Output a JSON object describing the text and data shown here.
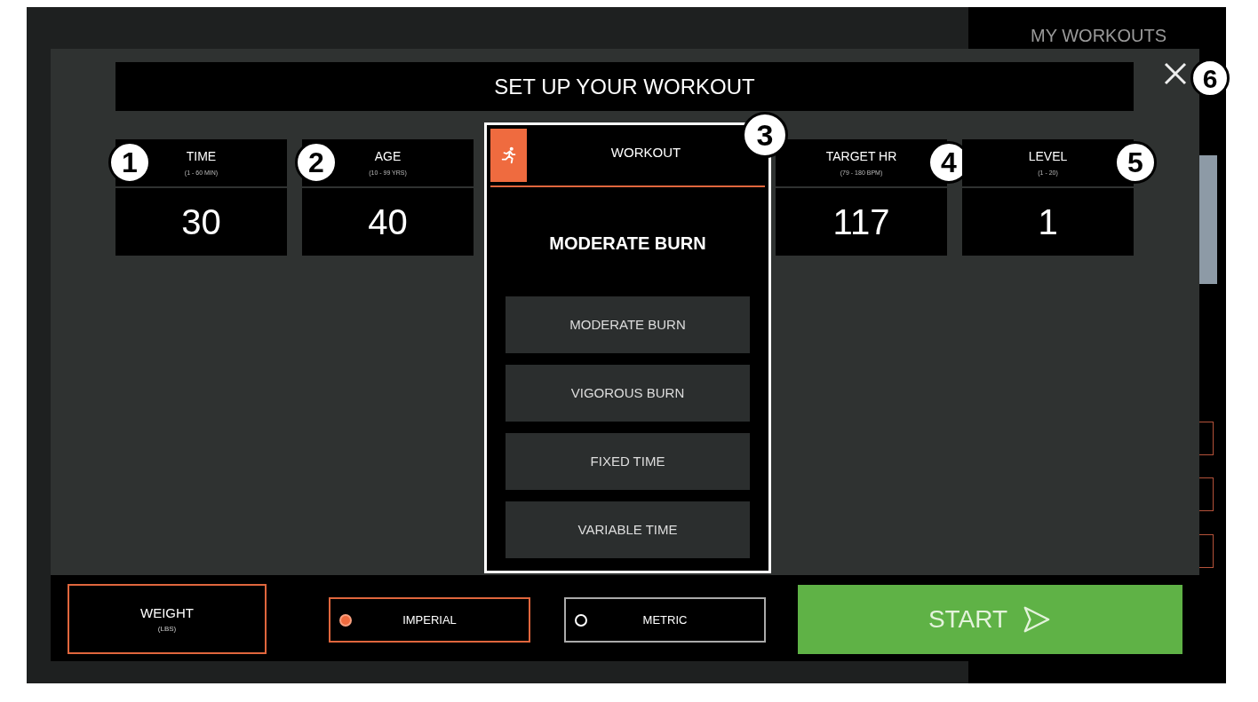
{
  "background": {
    "side_panel_title": "MY WORKOUTS"
  },
  "dialog": {
    "title": "SET UP YOUR WORKOUT",
    "close_callout": "6"
  },
  "fields": [
    {
      "label": "TIME",
      "range": "(1 - 60 MIN)",
      "value": "30",
      "callout": "1"
    },
    {
      "label": "AGE",
      "range": "(10 - 99 YRS)",
      "value": "40",
      "callout": "2"
    }
  ],
  "workout": {
    "label": "WORKOUT",
    "callout": "3",
    "current": "MODERATE BURN",
    "options": [
      {
        "label": "MODERATE BURN"
      },
      {
        "label": "VIGOROUS BURN"
      },
      {
        "label": "FIXED TIME"
      },
      {
        "label": "VARIABLE TIME"
      }
    ]
  },
  "fields_right": [
    {
      "label": "TARGET HR",
      "range": "(79 - 180 BPM)",
      "value": "117",
      "callout": "4"
    },
    {
      "label": "LEVEL",
      "range": "(1 - 20)",
      "value": "1",
      "callout": "5"
    }
  ],
  "weight": {
    "label": "WEIGHT",
    "unit": "(LBS)"
  },
  "units": [
    {
      "label": "IMPERIAL",
      "selected": true
    },
    {
      "label": "METRIC",
      "selected": false
    }
  ],
  "start_button": "START"
}
